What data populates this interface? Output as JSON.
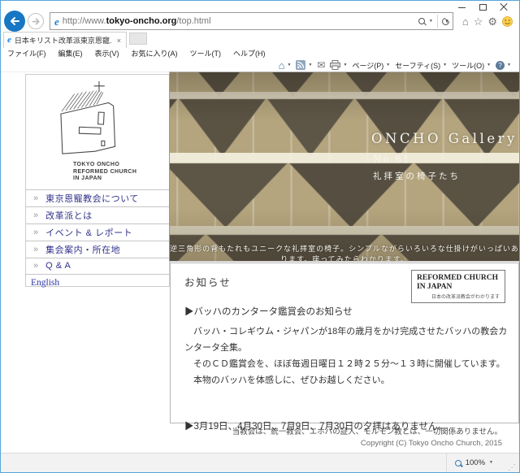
{
  "icons": {
    "home": "⌂",
    "favorites": "☆",
    "settings": "⚙",
    "mail": "✉",
    "caret": "▼",
    "help": "?",
    "nav_bullet": "»",
    "grip": "⋰",
    "ie_logo": "e",
    "tab_close": "×"
  },
  "browser": {
    "url_prefix": "http://www.",
    "url_domain": "tokyo-oncho.org",
    "url_path": "/top.html",
    "tab_title": "日本キリスト改革派東京恩寵...",
    "menu": [
      "ファイル(F)",
      "編集(E)",
      "表示(V)",
      "お気に入り(A)",
      "ツール(T)",
      "ヘルプ(H)"
    ],
    "commands": {
      "page": "ページ(P)",
      "safety": "セーフティ(S)",
      "tools": "ツール(O)"
    },
    "zoom_level": "100%"
  },
  "sidebar": {
    "logo_lines": [
      "TOKYO ONCHO",
      "REFORMED CHURCH",
      "IN JAPAN"
    ],
    "nav": [
      {
        "label": "東京恩寵教会について"
      },
      {
        "label": "改革派とは"
      },
      {
        "label": "イベント & レポート"
      },
      {
        "label": "集会案内・所在地"
      },
      {
        "label": "Q & A"
      }
    ],
    "english_link": "English"
  },
  "hero": {
    "gallery_title": "ONCHO Gallery",
    "gallery_no": "No.61",
    "gallery_subtitle": "礼拝室の椅子たち",
    "caption": "逆三角形の背もたれもユニークな礼拝室の椅子。シンプルながらいろいろな仕掛けがいっぱいあります。座ってみたらわかります。"
  },
  "news": {
    "heading": "お知らせ",
    "badge": {
      "line1": "REFORMED CHURCH",
      "line2": "IN JAPAN",
      "subtitle": "日本の改革派教会がわかります"
    },
    "items": [
      {
        "title": "▶バッハのカンタータ鑑賞会のお知らせ",
        "body": [
          "　バッハ・コレギウム・ジャパンが18年の歳月をかけ完成させたバッハの教会カンタータ全集。",
          "　そのＣＤ鑑賞会を、ほぼ毎週日曜日１２時２５分～１３時に開催しています。",
          "　本物のバッハを体感しに、ぜひお越しください。"
        ]
      },
      {
        "title": "▶3月19日、4月30日、7月9日、7月30日の夕拝はありません。"
      }
    ],
    "footer_note": "当教会は、統一教会、エホバの証人、モルモン教とは、一切関係ありません。",
    "copyright": "Copyright (C) Tokyo Oncho Church, 2015"
  },
  "colors": {
    "window_border": "#57a4d9",
    "back_button": "#1777c4",
    "nav_link": "#32328c",
    "hero_chair": "#5a5244",
    "hero_background": "#b4a57e",
    "smiley": "#fcd050"
  }
}
